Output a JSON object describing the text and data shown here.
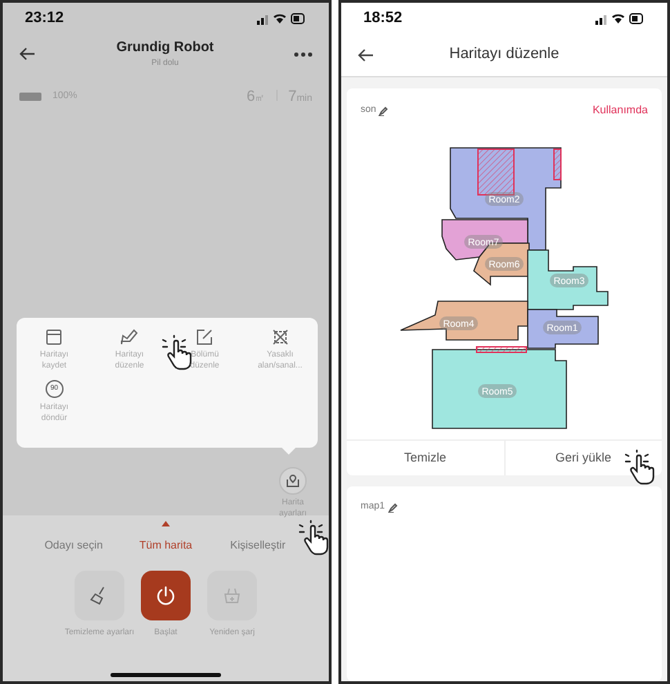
{
  "left_screen": {
    "status_bar": {
      "time": "23:12"
    },
    "header": {
      "title": "Grundig Robot",
      "subtitle": "Pil dolu"
    },
    "battery": {
      "reading": "100%"
    },
    "stats": {
      "area": "6",
      "area_unit": "㎡",
      "duration": "7",
      "duration_unit": "min"
    },
    "map_menu": [
      {
        "kind": "save",
        "label": "Haritayı kaydet"
      },
      {
        "kind": "edit_map",
        "label": "Haritayı düzenle"
      },
      {
        "kind": "edit_section",
        "label": "Bölümü düzenle"
      },
      {
        "kind": "forbidden",
        "label": "Yasaklı alan/sanal..."
      },
      {
        "kind": "rotate",
        "label": "Haritayı döndür",
        "badge": "90"
      }
    ],
    "map_settings": {
      "label": "Harita ayarları"
    },
    "tabs": [
      {
        "label": "Odayı seçin",
        "selected": false
      },
      {
        "label": "Tüm harita",
        "selected": true
      },
      {
        "label": "Kişiselleştir",
        "selected": false
      }
    ],
    "actions": [
      {
        "kind": "settings",
        "label": "Temizleme ayarları"
      },
      {
        "kind": "start",
        "label": "Başlat"
      },
      {
        "kind": "recharge",
        "label": "Yeniden şarj"
      }
    ]
  },
  "right_screen": {
    "status_bar": {
      "time": "18:52"
    },
    "header": {
      "title": "Haritayı düzenle"
    },
    "maps": [
      {
        "name": "son",
        "status": "Kullanımda",
        "rooms": [
          {
            "label": "Room2",
            "color": "#a9b4e8"
          },
          {
            "label": "Room7",
            "color": "#e3a2d6"
          },
          {
            "label": "Room6",
            "color": "#e8b898"
          },
          {
            "label": "Room3",
            "color": "#9fe6df"
          },
          {
            "label": "Room4",
            "color": "#e8b898"
          },
          {
            "label": "Room1",
            "color": "#a9b4e8"
          },
          {
            "label": "Room5",
            "color": "#9fe6df"
          }
        ],
        "buttons": [
          "Temizle",
          "Geri yükle"
        ]
      },
      {
        "name": "map1"
      }
    ]
  }
}
